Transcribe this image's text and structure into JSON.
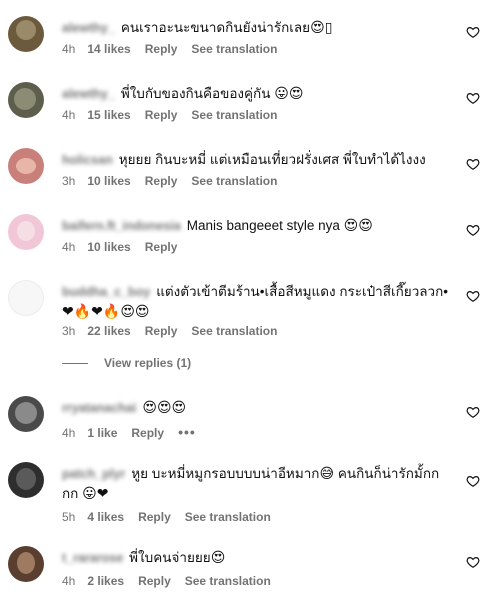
{
  "comments": [
    {
      "user": "alewthy_",
      "text": "คนเราอะนะขนาดกินยังน่ารักเลย",
      "emoji": "😍▯",
      "time": "4h",
      "likes": "14 likes",
      "reply": "Reply",
      "translate": "See translation"
    },
    {
      "user": "alewthy_",
      "text": "พี่ใบกับของกินคือของคู่กัน",
      "emoji": "😛😍",
      "time": "4h",
      "likes": "15 likes",
      "reply": "Reply",
      "translate": "See translation"
    },
    {
      "user": "holicsan",
      "text": "หุยยย กินบะหมี่ แต่เหมือนเที่ยวฝรั่งเศส พี่ใบทำได้ไงงง",
      "emoji": "",
      "time": "3h",
      "likes": "10 likes",
      "reply": "Reply",
      "translate": "See translation"
    },
    {
      "user": "baifern.ft_indonesia",
      "text": "Manis bangeeet style nya",
      "emoji": "😍😍",
      "time": "4h",
      "likes": "10 likes",
      "reply": "Reply",
      "translate": ""
    },
    {
      "user": "buddha_c_boy",
      "text": "แต่งตัวเข้าตีมร้าน•เสื้อสีหมูแดง กระเป๋าสีเกี๊ยวลวก•",
      "emoji2": "❤🔥❤🔥😍😍",
      "time": "3h",
      "likes": "22 likes",
      "reply": "Reply",
      "translate": "See translation"
    },
    {
      "user": "rryatanachai",
      "text": "",
      "emoji": "😍😍😍",
      "time": "4h",
      "likes": "1 like",
      "reply": "Reply",
      "translate": "",
      "more": "•••"
    },
    {
      "user": "patch_plyr",
      "text": "หูย บะหมี่หมูกรอบบบบน่าอีหมาก",
      "emoji": "😅",
      "text_b": "คนกินก็น่ารักมั้กก",
      "line2_text": "กก",
      "emoji2": "😛❤",
      "time": "5h",
      "likes": "4 likes",
      "reply": "Reply",
      "translate": "See translation"
    },
    {
      "user": "t_rararose",
      "text": "พี่ใบคนจ่ายยย",
      "emoji": "😍",
      "time": "4h",
      "likes": "2 likes",
      "reply": "Reply",
      "translate": "See translation"
    }
  ],
  "view_replies": "View replies (1)",
  "icons": {
    "like": "heart-outline-icon"
  },
  "colors": {
    "meta": "#737373",
    "text": "#111111"
  }
}
